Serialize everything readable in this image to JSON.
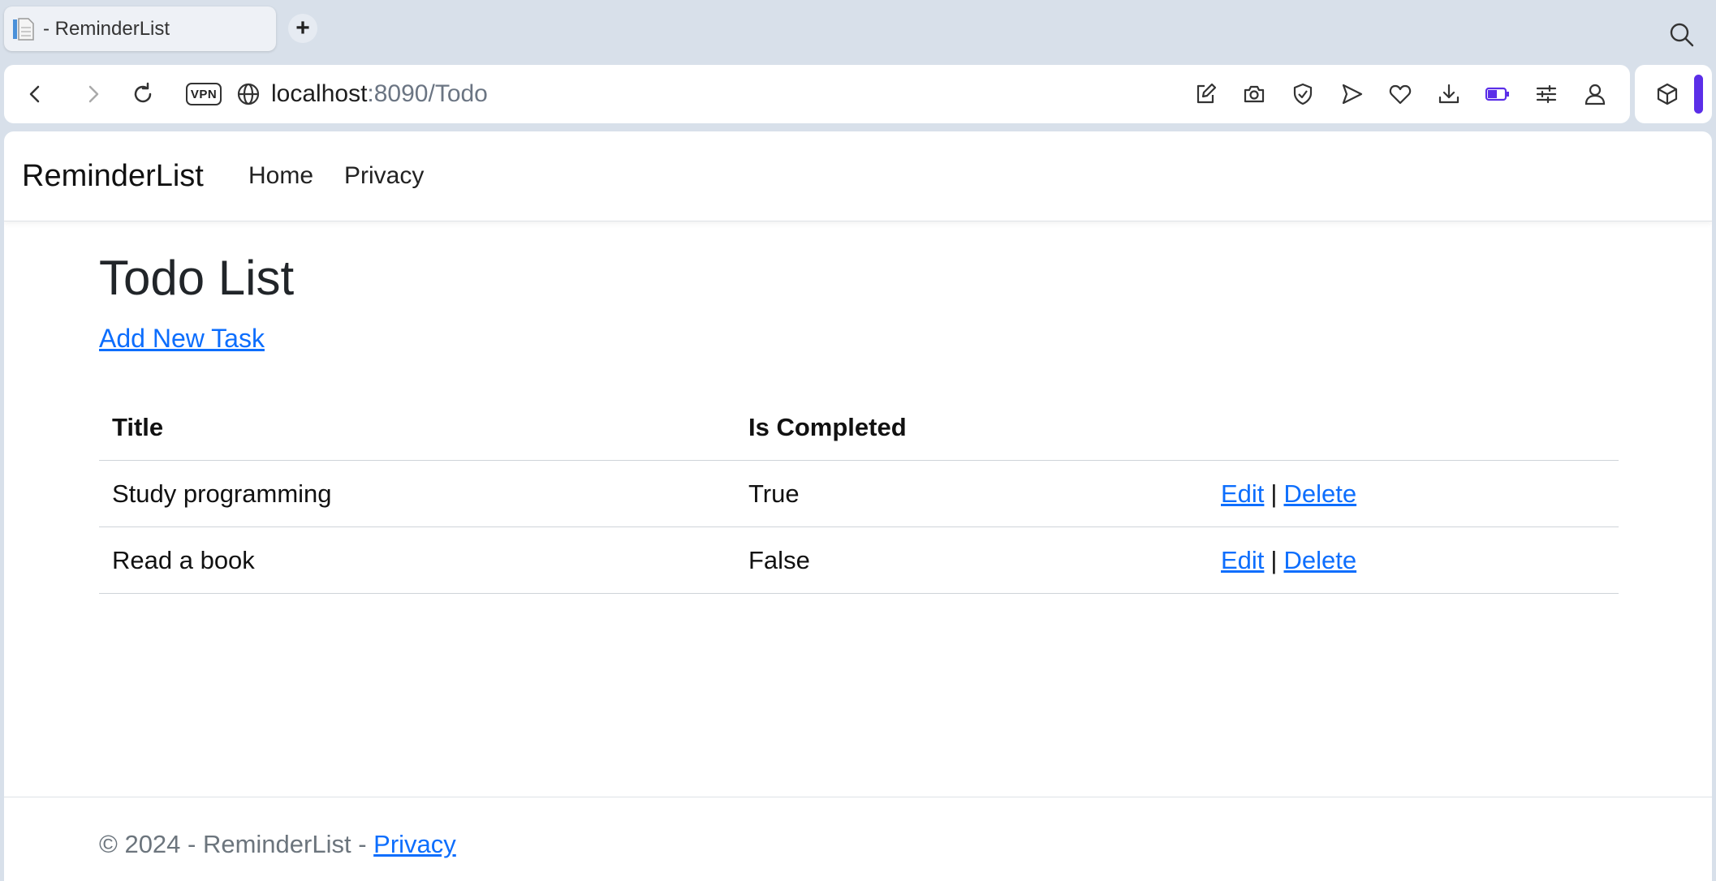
{
  "browser": {
    "tab": {
      "title": "- ReminderList",
      "icon": "document-icon"
    },
    "new_tab": "+",
    "address": {
      "vpn_label": "VPN",
      "url_host": "localhost",
      "url_rest": ":8090/Todo"
    },
    "toolbar_icons": [
      "edit-icon",
      "camera-icon",
      "shield-icon",
      "send-icon",
      "heart-icon",
      "download-icon",
      "battery-icon",
      "settings-sliders-icon",
      "profile-icon"
    ],
    "accent_color": "#5b2ee8"
  },
  "navbar": {
    "brand": "ReminderList",
    "links": [
      "Home",
      "Privacy"
    ]
  },
  "main": {
    "title": "Todo List",
    "add_link": "Add New Task",
    "table": {
      "headers": [
        "Title",
        "Is Completed",
        ""
      ],
      "rows": [
        {
          "title": "Study programming",
          "completed": "True",
          "edit": "Edit",
          "delete": "Delete"
        },
        {
          "title": "Read a book",
          "completed": "False",
          "edit": "Edit",
          "delete": "Delete"
        }
      ],
      "separator": "|"
    }
  },
  "footer": {
    "text": "© 2024 - ReminderList - ",
    "link": "Privacy"
  },
  "colors": {
    "link": "#0d6efd",
    "chrome_bg": "#d8e0ea"
  }
}
